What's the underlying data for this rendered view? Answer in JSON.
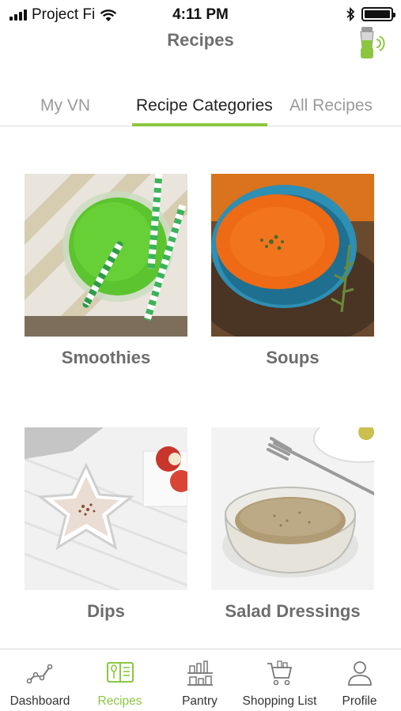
{
  "status_bar": {
    "carrier": "Project Fi",
    "time": "4:11 PM",
    "icons": [
      "signal-icon",
      "wifi-icon",
      "bluetooth-icon",
      "battery-icon"
    ]
  },
  "header": {
    "title": "Recipes",
    "right_icon": "blender-connected-icon"
  },
  "tabs": [
    {
      "label": "My VN",
      "active": false
    },
    {
      "label": "Recipe Categories",
      "active": true
    },
    {
      "label": "All Recipes",
      "active": false
    }
  ],
  "categories": [
    {
      "label": "Smoothies",
      "image": "green-smoothie-photo"
    },
    {
      "label": "Soups",
      "image": "tomato-soup-photo"
    },
    {
      "label": "Dips",
      "image": "star-bowl-dip-photo"
    },
    {
      "label": "Salad Dressings",
      "image": "dressing-bowl-photo"
    }
  ],
  "bottom_nav": [
    {
      "label": "Dashboard",
      "icon": "chart-line-icon",
      "active": false
    },
    {
      "label": "Recipes",
      "icon": "recipe-book-icon",
      "active": true
    },
    {
      "label": "Pantry",
      "icon": "pantry-shelf-icon",
      "active": false
    },
    {
      "label": "Shopping List",
      "icon": "shopping-cart-icon",
      "active": false
    },
    {
      "label": "Profile",
      "icon": "person-icon",
      "active": false
    }
  ],
  "colors": {
    "accent": "#8cc63f",
    "title": "#6f6f6f",
    "inactive_tab": "#9a9a9a"
  }
}
